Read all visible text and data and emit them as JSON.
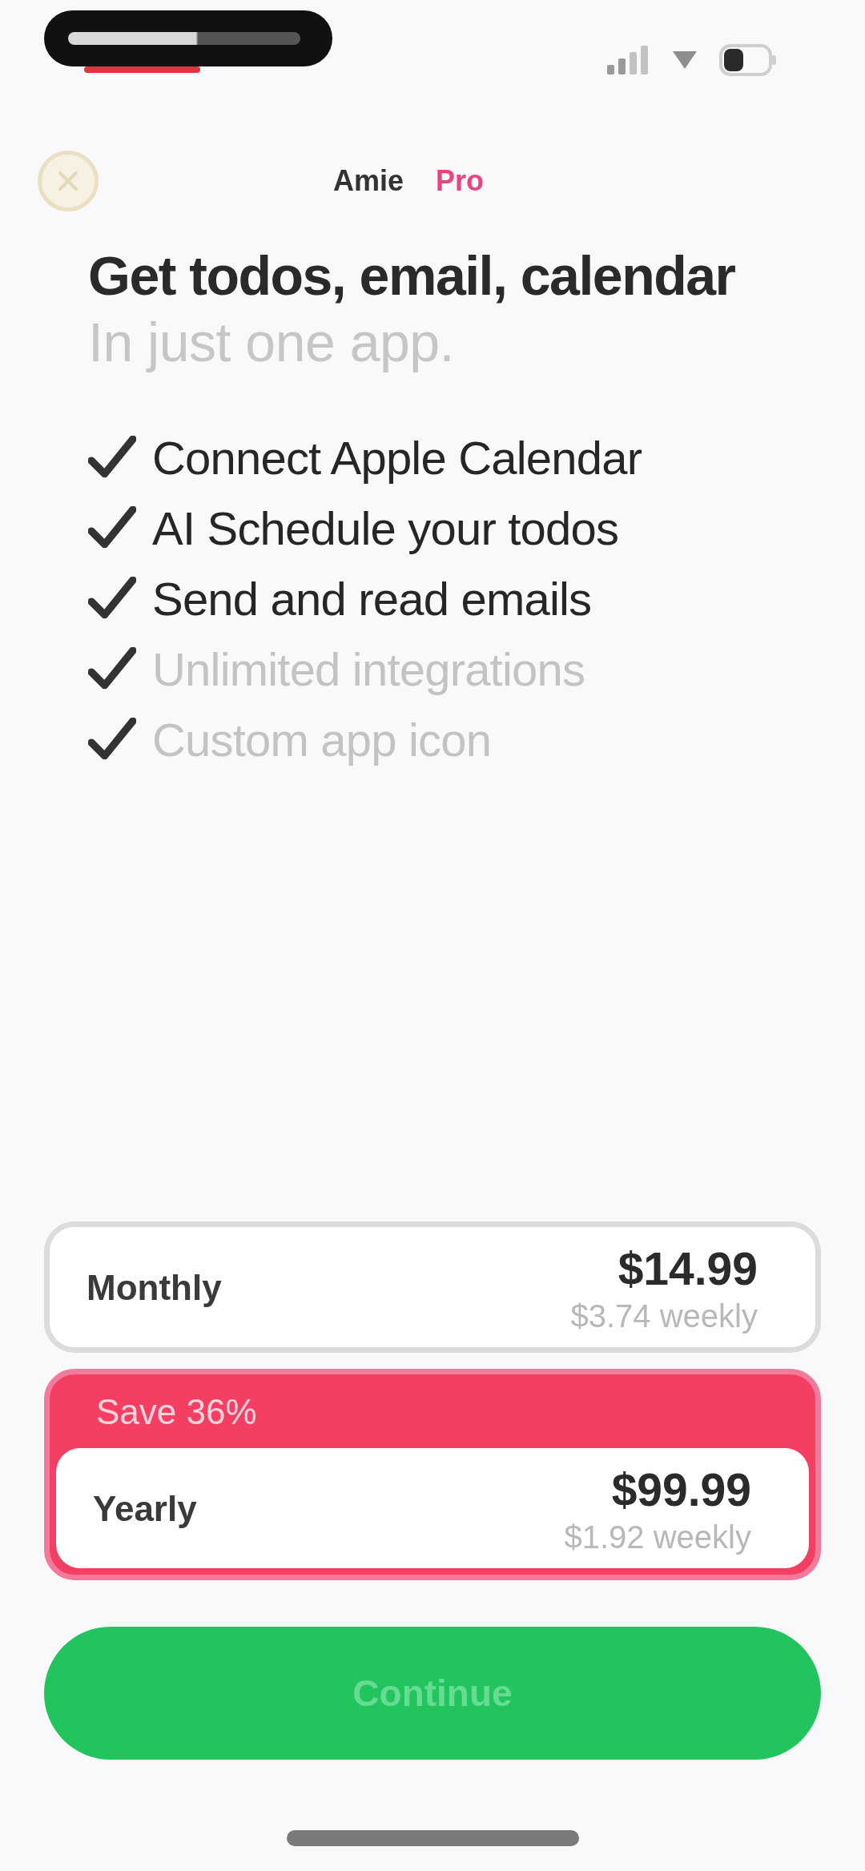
{
  "header": {
    "brand": "Amie",
    "badge": "Pro"
  },
  "headline": {
    "title": "Get todos, email, calendar",
    "subtitle": "In just one app."
  },
  "features": [
    {
      "label": "Connect Apple Calendar",
      "dimmed": false
    },
    {
      "label": "AI Schedule your todos",
      "dimmed": false
    },
    {
      "label": "Send and read emails",
      "dimmed": false
    },
    {
      "label": "Unlimited integrations",
      "dimmed": true
    },
    {
      "label": "Custom app icon",
      "dimmed": true
    }
  ],
  "plans": [
    {
      "name": "Monthly",
      "price": "$14.99",
      "weekly": "$3.74 weekly",
      "selected": false
    },
    {
      "name": "Yearly",
      "price": "$99.99",
      "weekly": "$1.92 weekly",
      "selected": true,
      "badge": "Save 36%"
    }
  ],
  "continue_button": {
    "label": "Continue"
  }
}
